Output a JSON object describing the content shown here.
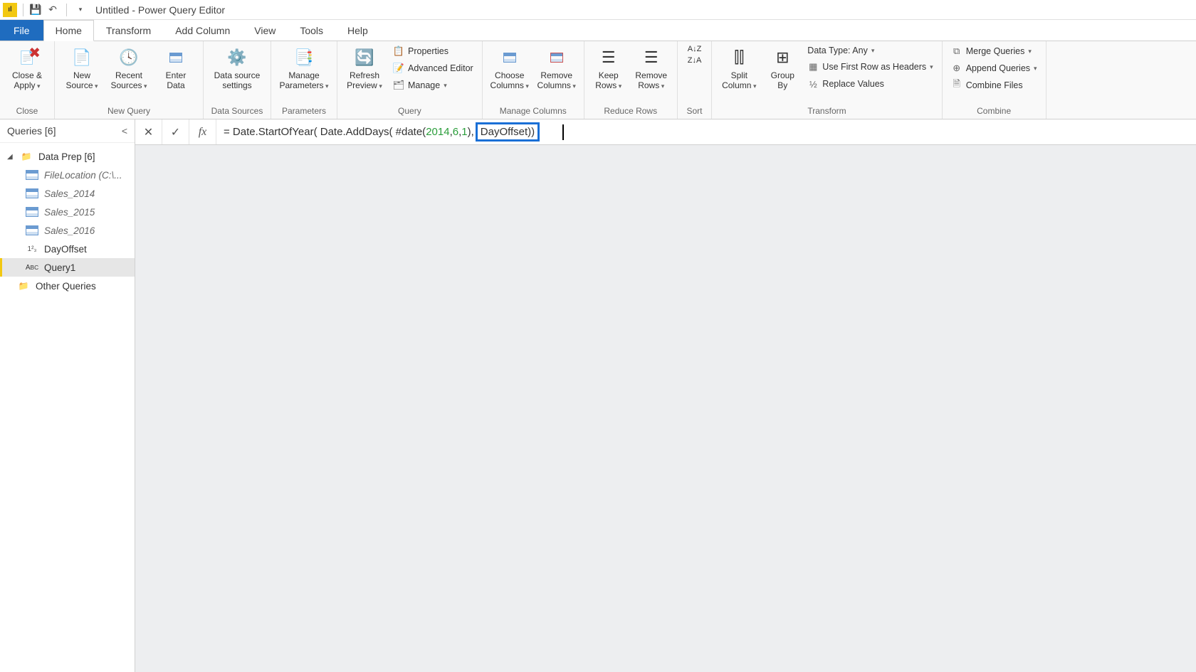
{
  "titlebar": {
    "title": "Untitled - Power Query Editor"
  },
  "tabs": {
    "file": "File",
    "home": "Home",
    "transform": "Transform",
    "addcol": "Add Column",
    "view": "View",
    "tools": "Tools",
    "help": "Help"
  },
  "ribbon": {
    "close": {
      "closeapply": "Close &\nApply",
      "group": "Close"
    },
    "newquery": {
      "newsource": "New\nSource",
      "recent": "Recent\nSources",
      "enter": "Enter\nData",
      "group": "New Query"
    },
    "datasources": {
      "settings": "Data source\nsettings",
      "group": "Data Sources"
    },
    "parameters": {
      "manage": "Manage\nParameters",
      "group": "Parameters"
    },
    "query": {
      "refresh": "Refresh\nPreview",
      "properties": "Properties",
      "advanced": "Advanced Editor",
      "manage": "Manage",
      "group": "Query"
    },
    "cols": {
      "choose": "Choose\nColumns",
      "remove": "Remove\nColumns",
      "group": "Manage Columns"
    },
    "rows": {
      "keep": "Keep\nRows",
      "removerows": "Remove\nRows",
      "group": "Reduce Rows"
    },
    "sort": {
      "group": "Sort"
    },
    "transform": {
      "split": "Split\nColumn",
      "groupby": "Group\nBy",
      "dtype": "Data Type: Any",
      "firstrow": "Use First Row as Headers",
      "replace": "Replace Values",
      "group": "Transform"
    },
    "combine": {
      "merge": "Merge Queries",
      "append": "Append Queries",
      "combinefiles": "Combine Files",
      "group": "Combine"
    }
  },
  "queries": {
    "header": "Queries [6]",
    "group": "Data Prep [6]",
    "items": [
      {
        "label": "FileLocation (C:\\...",
        "type": "table",
        "italic": true
      },
      {
        "label": "Sales_2014",
        "type": "table",
        "italic": true
      },
      {
        "label": "Sales_2015",
        "type": "table",
        "italic": true
      },
      {
        "label": "Sales_2016",
        "type": "table",
        "italic": true
      },
      {
        "label": "DayOffset",
        "type": "num"
      },
      {
        "label": "Query1",
        "type": "abc",
        "selected": true
      }
    ],
    "other": "Other Queries"
  },
  "formula": {
    "prefix": "= Date.StartOfYear(  Date.AddDays(  #date(",
    "y": "2014",
    "c1": ", ",
    "m": "6",
    "c2": ",",
    "d": "1",
    "mid": "),",
    "highlight": "DayOffset))",
    "suffix": ""
  }
}
